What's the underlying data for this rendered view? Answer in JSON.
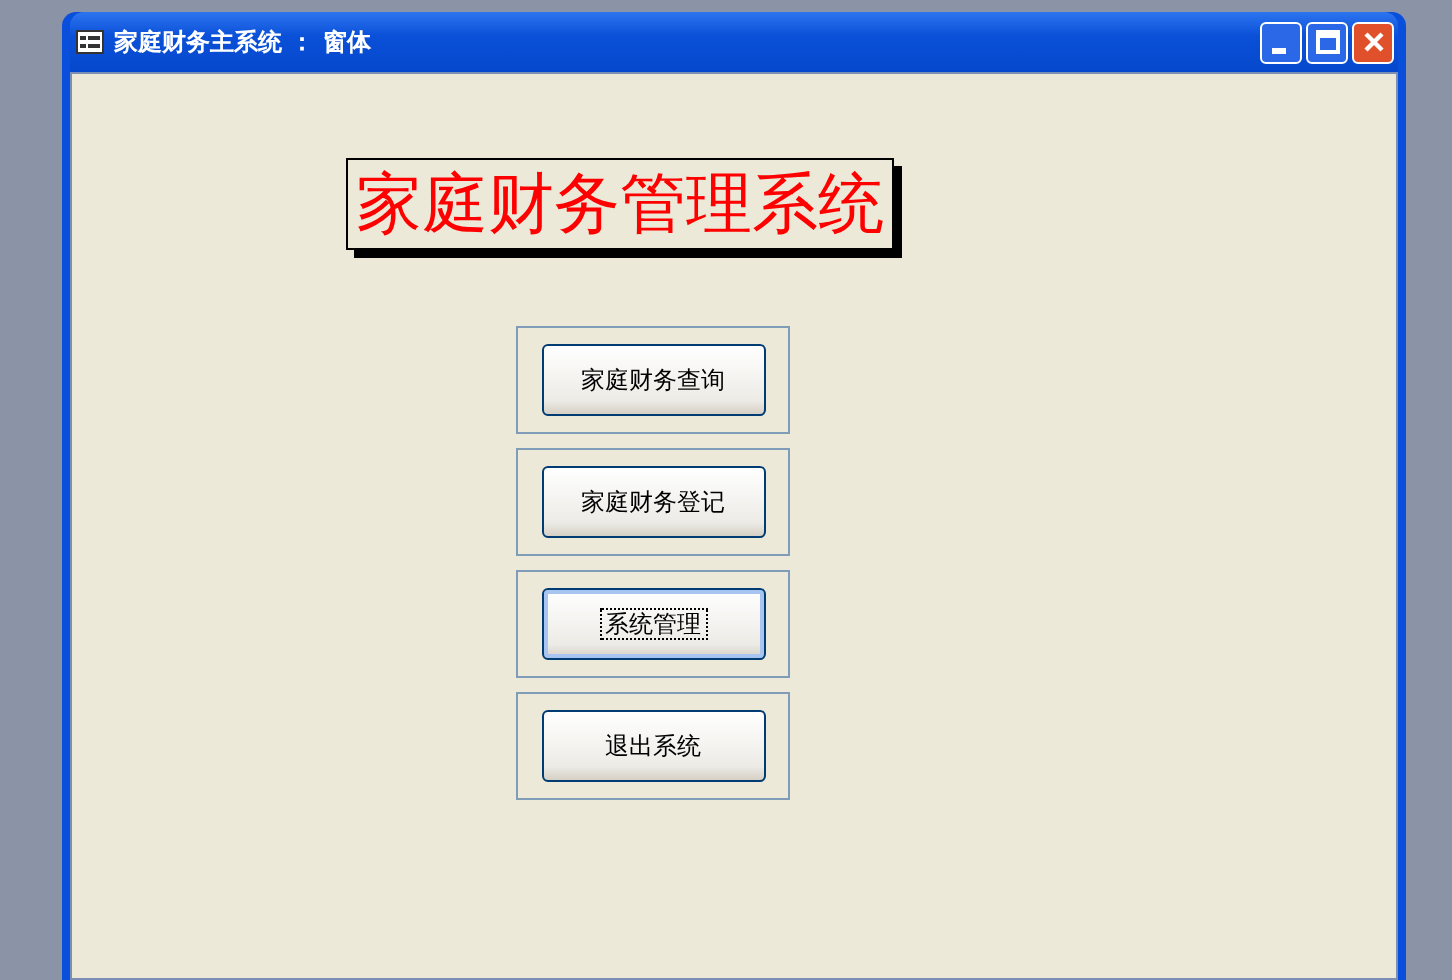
{
  "window": {
    "title": "家庭财务主系统 ： 窗体"
  },
  "heading": "家庭财务管理系统",
  "buttons": [
    {
      "label": "家庭财务查询",
      "focused": false
    },
    {
      "label": "家庭财务登记",
      "focused": false
    },
    {
      "label": "系统管理",
      "focused": true
    },
    {
      "label": "退出系统",
      "focused": false
    }
  ]
}
